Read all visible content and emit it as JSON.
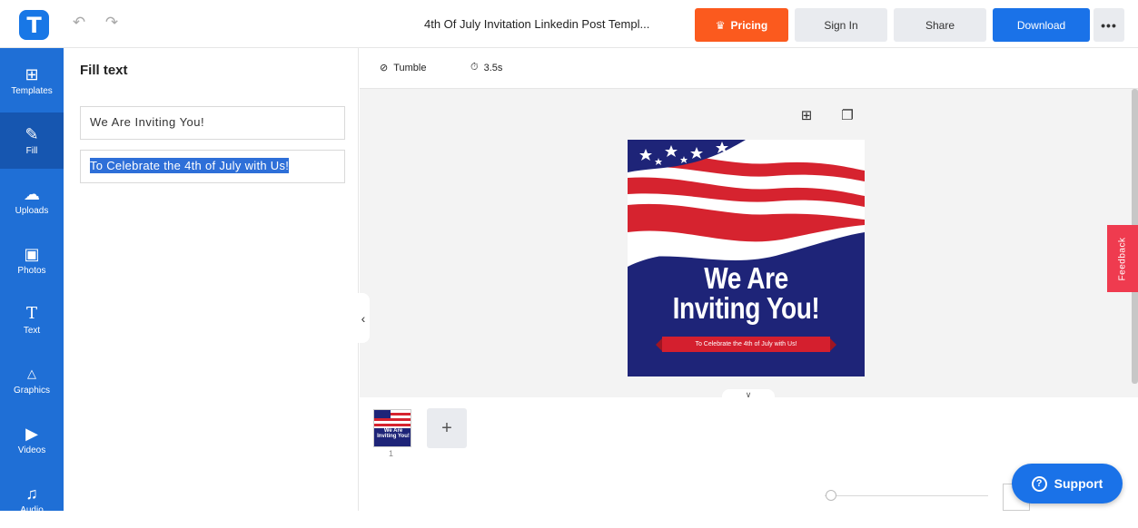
{
  "colors": {
    "brand": "#1877e6",
    "pricing": "#fb5a1e",
    "download": "#1a72e8",
    "rail": "#1f6fd6",
    "rail_active": "#1656b0",
    "feedback": "#ef3b4f",
    "design_bg": "#1e2478",
    "ribbon": "#d41f2e"
  },
  "topbar": {
    "logo": "T",
    "undo_icon": "undo-icon",
    "redo_icon": "redo-icon",
    "title": "4th Of July Invitation Linkedin Post Templ...",
    "pricing_label": "Pricing",
    "signin_label": "Sign In",
    "share_label": "Share",
    "download_label": "Download",
    "more_label": "•••"
  },
  "rail": {
    "items": [
      {
        "label": "Templates",
        "icon": "templates-icon"
      },
      {
        "label": "Fill",
        "icon": "pencil-icon",
        "active": true
      },
      {
        "label": "Uploads",
        "icon": "cloud-upload-icon"
      },
      {
        "label": "Photos",
        "icon": "photo-icon"
      },
      {
        "label": "Text",
        "icon": "text-icon"
      },
      {
        "label": "Graphics",
        "icon": "shapes-icon"
      },
      {
        "label": "Videos",
        "icon": "video-icon"
      },
      {
        "label": "Audio",
        "icon": "music-icon"
      }
    ]
  },
  "panel": {
    "title": "Fill text",
    "fields": [
      {
        "value": "We Are Inviting You!"
      },
      {
        "value": "To Celebrate the 4th of July with Us!"
      }
    ]
  },
  "animation": {
    "effect": "Tumble",
    "duration": "3.5s"
  },
  "design": {
    "headline_line1": "We Are",
    "headline_line2": "Inviting You!",
    "ribbon_text": "To Celebrate the 4th of July with Us!"
  },
  "feedback_label": "Feedback",
  "pages": {
    "thumb_text": "We Are Inviting You!",
    "page_number": "1",
    "add_label": "+"
  },
  "support_label": "Support"
}
